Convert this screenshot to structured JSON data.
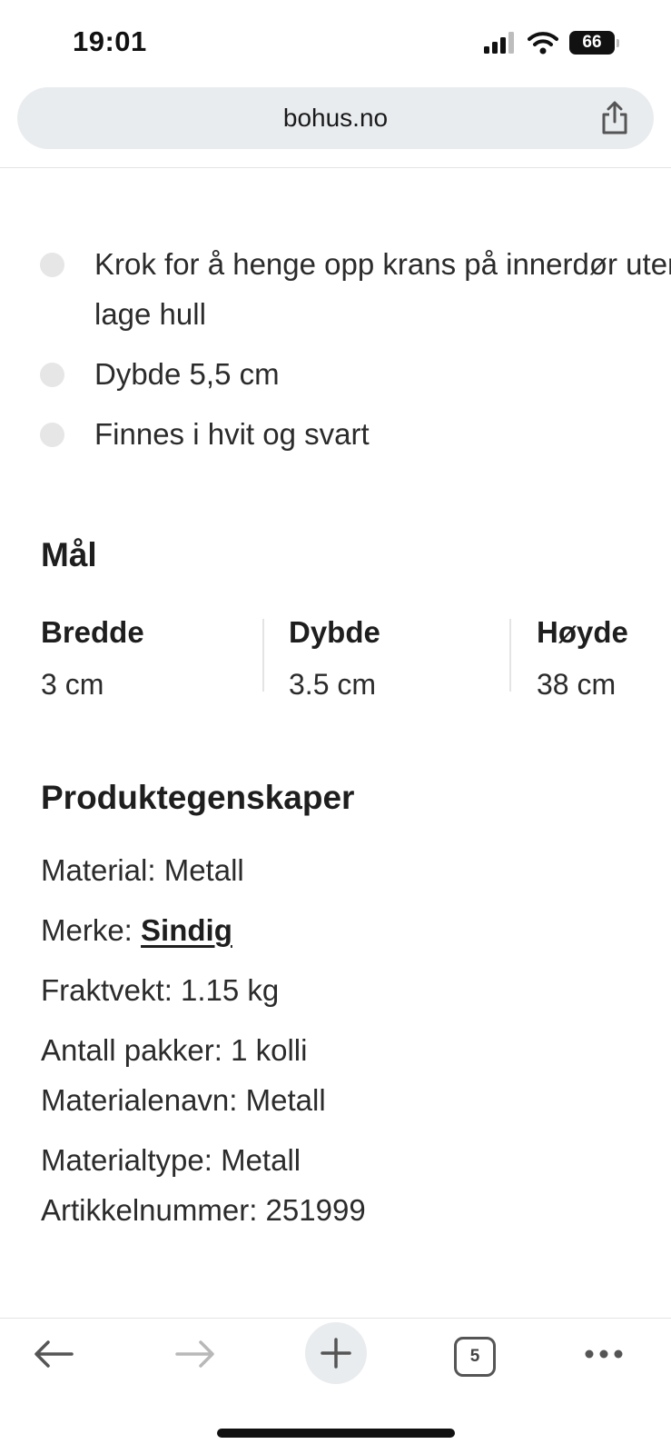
{
  "status_bar": {
    "time": "19:01",
    "battery": "66"
  },
  "browser": {
    "url": "bohus.no",
    "tabs_count": "5"
  },
  "bullets": [
    "Krok for å henge opp krans på innerdør uten å lage hull",
    "Dybde 5,5 cm",
    "Finnes i hvit og svart"
  ],
  "dimensions": {
    "title": "Mål",
    "items": [
      {
        "label": "Bredde",
        "value": "3 cm"
      },
      {
        "label": "Dybde",
        "value": "3.5 cm"
      },
      {
        "label": "Høyde",
        "value": "38 cm"
      }
    ]
  },
  "properties": {
    "title": "Produktegenskaper",
    "material": "Material: Metall",
    "brand_label": "Merke: ",
    "brand_value": "Sindig",
    "shipping_weight": "Fraktvekt: 1.15 kg",
    "packages": "Antall pakker: 1 kolli",
    "material_name": "Materialenavn: Metall",
    "material_type": "Materialtype: Metall",
    "article_number": "Artikkelnummer: 251999"
  }
}
